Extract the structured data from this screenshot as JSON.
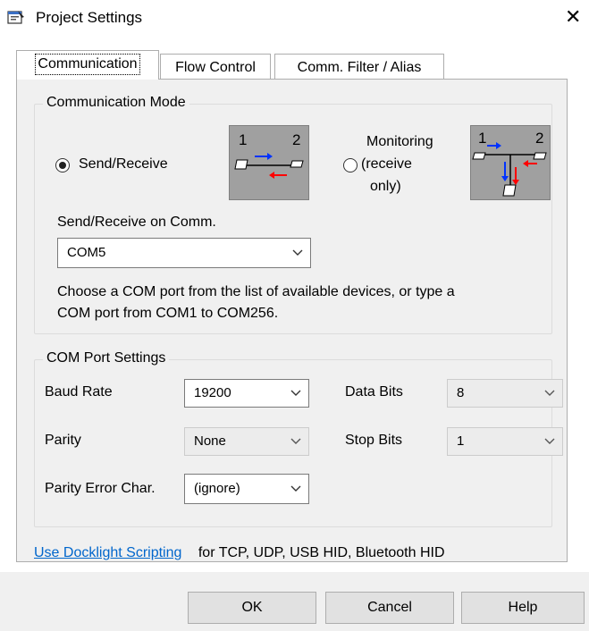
{
  "window": {
    "title": "Project Settings",
    "close_glyph": "✕"
  },
  "tabs": [
    {
      "label": "Communication",
      "active": true
    },
    {
      "label": "Flow Control",
      "active": false
    },
    {
      "label": "Comm. Filter / Alias",
      "active": false
    }
  ],
  "comm_mode": {
    "legend": "Communication Mode",
    "send_receive_label": "Send/Receive",
    "send_receive_selected": true,
    "monitoring_label_line1": "Monitoring",
    "monitoring_label_line2": "(receive",
    "monitoring_label_line3": "only)",
    "monitoring_selected": false,
    "diagram_left_num1": "1",
    "diagram_left_num2": "2",
    "diagram_right_num1": "1",
    "diagram_right_num2": "2",
    "comm_label": "Send/Receive on Comm.",
    "comm_value": "COM5",
    "help_text_line1": "Choose a COM port from the list of available devices, or type a",
    "help_text_line2": "COM port from COM1 to COM256."
  },
  "port_settings": {
    "legend": "COM Port Settings",
    "baud_rate_label": "Baud Rate",
    "baud_rate_value": "19200",
    "data_bits_label": "Data Bits",
    "data_bits_value": "8",
    "parity_label": "Parity",
    "parity_value": "None",
    "stop_bits_label": "Stop Bits",
    "stop_bits_value": "1",
    "parity_error_label": "Parity Error Char.",
    "parity_error_value": "(ignore)"
  },
  "footer_link": {
    "link_text": "Use Docklight Scripting",
    "suffix_text": "for TCP, UDP, USB HID, Bluetooth HID"
  },
  "buttons": {
    "ok": "OK",
    "cancel": "Cancel",
    "help": "Help"
  },
  "colors": {
    "link": "#0066cc",
    "panel_bg": "#f0f0f0",
    "arrow_blue": "#0033ff",
    "arrow_red": "#ff0000"
  }
}
